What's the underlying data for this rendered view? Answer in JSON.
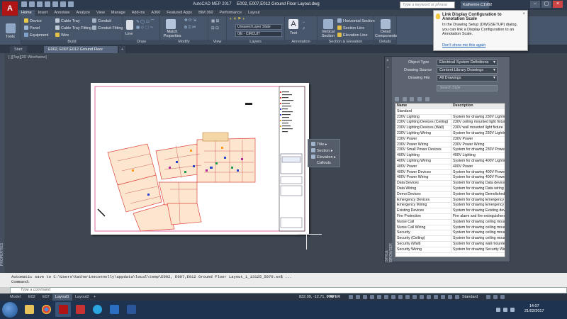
{
  "window": {
    "app_name": "AutoCAD MEP 2017",
    "document_title": "E002, E007,E012 Ground Floor Layout.dwg",
    "search_placeholder": "Type a keyword or phrase",
    "user": "Katherine.C1982"
  },
  "app_logo": "A",
  "ribbon_tabs": [
    "Home",
    "Insert",
    "Annotate",
    "Analyze",
    "View",
    "Manage",
    "Add-ins",
    "A360",
    "Featured Apps",
    "BIM 360",
    "Performance",
    "Layout"
  ],
  "ribbon_active_tab": "Home",
  "ribbon": {
    "tools_label": "Tools",
    "build": {
      "items": [
        "Device",
        "Panel",
        "Equipment",
        "Cable Tray",
        "Cable Tray Fitting",
        "Wire",
        "Conduit",
        "Conduit Fitting"
      ],
      "label": "Build"
    },
    "draw": {
      "items": [
        "Line"
      ],
      "label": "Draw"
    },
    "modify": {
      "items": [
        "Match Properties"
      ],
      "label": "Modify"
    },
    "view": {
      "label": "View"
    },
    "layers": {
      "layer_state": "Unsaved Layer State",
      "current_layer": "0|E - CIRCUIT",
      "label": "Layers"
    },
    "annotation": {
      "items": [
        "Text"
      ],
      "label": "Annotation"
    },
    "section_elevation": {
      "items": [
        "Vertical Section",
        "Horizontal Section",
        "Section Line",
        "Elevation Line"
      ],
      "label": "Section & Elevation"
    },
    "details": {
      "items": [
        "Detail Components"
      ],
      "label": "Details"
    }
  },
  "notification": {
    "title": "Link Display Configuration to Annotation Scale",
    "body": "In the Drawing Setup (DWGSETUP) dialog, you can link a Display Configuration to an Annotation Scale.",
    "link": "Don't show me this again"
  },
  "file_tabs": [
    "Start",
    "E002, E007,E012 Ground Floor Layout*"
  ],
  "active_file_tab": 1,
  "viewport_label": "[-][Top][2D Wireframe]",
  "properties_label": "PROPERTIES",
  "callout_menu": {
    "items": [
      "Title",
      "Section",
      "Elevation"
    ],
    "title": "Callouts"
  },
  "style_browser": {
    "side_label": "STYLE BROWSER",
    "object_type_label": "Object Type",
    "object_type": "Electrical System Definitions",
    "drawing_source_label": "Drawing Source",
    "drawing_source": "Content Library Drawings",
    "drawing_file_label": "Drawing File",
    "drawing_file": "All Drawings",
    "search_placeholder": "Search Style",
    "columns": [
      "Name",
      "Description"
    ],
    "rows": [
      [
        "Standard",
        ""
      ],
      [
        "230V Lighting",
        "System for drawing 230V Lighting"
      ],
      [
        "230V Lighting Devices (Ceiling)",
        "230V ceiling mounted light fixture"
      ],
      [
        "230V Lighting Devices (Wall)",
        "230V wall mounted light fixture"
      ],
      [
        "230V Lighting Wiring",
        "System for drawing 230V Lighting"
      ],
      [
        "230V Power",
        "230V Power"
      ],
      [
        "230V Power Wiring",
        "230V Power Wiring"
      ],
      [
        "230V Small Power Devices",
        "System for drawing 230V Power"
      ],
      [
        "400V Lighting",
        "400V Lighting"
      ],
      [
        "400V Lighting Wiring",
        "System for drawing 400V Lighting"
      ],
      [
        "400V Power",
        "400V Power"
      ],
      [
        "400V Power Devices",
        "System for drawing 400V Power"
      ],
      [
        "400V Power Wiring",
        "System for drawing 400V Power"
      ],
      [
        "Data Devices",
        "System for drawing Data devices"
      ],
      [
        "Data Wiring",
        "System for drawing Data wiring"
      ],
      [
        "Demo Devices",
        "System for drawing Demolished"
      ],
      [
        "Emergency Devices",
        "System for drawing Emergency"
      ],
      [
        "Emergency Wiring",
        "System for drawing Emergency"
      ],
      [
        "Existing Devices",
        "System for drawing Existing devices"
      ],
      [
        "Fire Protection",
        "Fire alarm and fire extinguishers"
      ],
      [
        "Nurse Call",
        "System for drawing ceiling mounted"
      ],
      [
        "Nurse Call Wiring",
        "System for drawing ceiling mounted"
      ],
      [
        "Security",
        "System for drawing ceiling mounted"
      ],
      [
        "Security (Ceiling)",
        "System for drawing ceiling mounted"
      ],
      [
        "Security (Wall)",
        "System for drawing wall mounted"
      ],
      [
        "Security Wiring",
        "System for drawing Security Wiring"
      ]
    ]
  },
  "command": {
    "history": "Automatic save to C:\\Users\\katherineconnolly\\appdata\\local\\temp\\E002, E007,E012 Ground Floor Layout_1_13125_5070.sv$ ...",
    "prompt": "Command:",
    "input_placeholder": "Type a command"
  },
  "layout_tabs": [
    "Model",
    "E02",
    "E07",
    "Layout1",
    "Layout2"
  ],
  "active_layout_tab": "Layout1",
  "status": {
    "coords": "832.09, -12.71, 0.00",
    "space": "PAPER",
    "standard": "Standard"
  },
  "clock": {
    "time": "14:07",
    "date": "21/02/2017"
  },
  "colors": {
    "accent": "#b01414",
    "ribbon_bg": "#48566b",
    "canvas_bg": "#3e4651",
    "plan_red": "#e04040",
    "plan_orange": "#e89a3a"
  }
}
